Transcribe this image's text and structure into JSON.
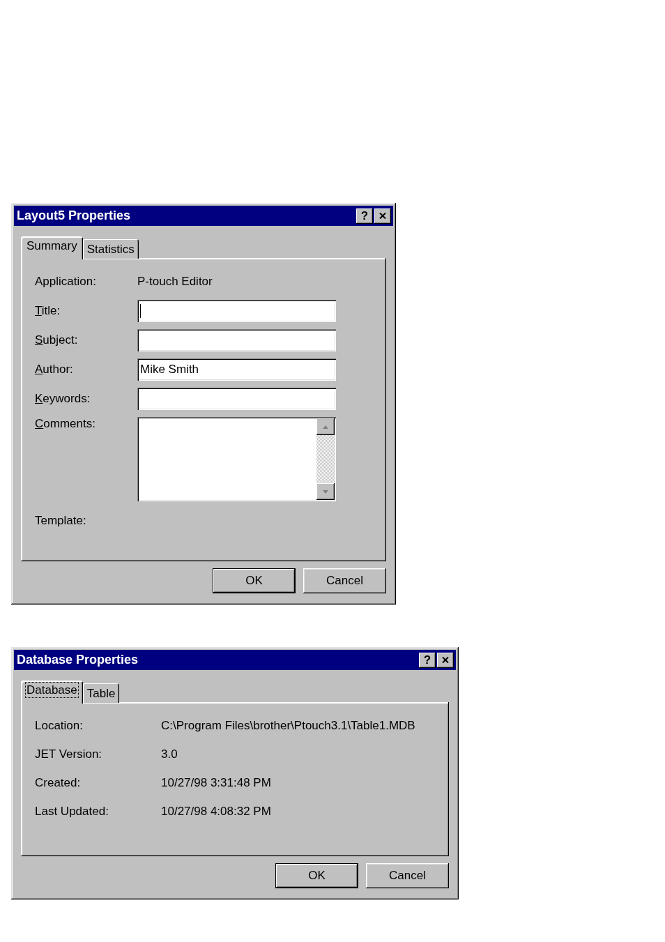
{
  "dialogs": [
    {
      "title": "Layout5 Properties",
      "help": "?",
      "tabs": [
        {
          "label": "Summary",
          "selected": true,
          "focused": false
        },
        {
          "label": "Statistics",
          "selected": false,
          "focused": false
        }
      ],
      "rows": [
        {
          "kind": "static",
          "label": "Application:",
          "value": "P-touch Editor",
          "underline_first": false
        },
        {
          "kind": "input",
          "label": "Title:",
          "value": "",
          "focused": true,
          "underline_first": true
        },
        {
          "kind": "input",
          "label": "Subject:",
          "value": "",
          "focused": false,
          "underline_first": true
        },
        {
          "kind": "input",
          "label": "Author:",
          "value": "Mike Smith",
          "focused": false,
          "underline_first": true
        },
        {
          "kind": "input",
          "label": "Keywords:",
          "value": "",
          "focused": false,
          "underline_first": true
        },
        {
          "kind": "textarea",
          "label": "Comments:",
          "value": "",
          "focused": false,
          "underline_first": true
        },
        {
          "kind": "label",
          "label": "Template:",
          "underline_first": false
        }
      ],
      "buttons": [
        {
          "label": "OK",
          "default": true
        },
        {
          "label": "Cancel",
          "default": false
        }
      ]
    },
    {
      "title": "Database Properties",
      "help": "?",
      "tabs": [
        {
          "label": "Database",
          "selected": true,
          "focused": true
        },
        {
          "label": "Table",
          "selected": false,
          "focused": false
        }
      ],
      "rows": [
        {
          "kind": "static",
          "label": "Location:",
          "value": "C:\\Program Files\\brother\\Ptouch3.1\\Table1.MDB",
          "underline_first": false
        },
        {
          "kind": "static",
          "label": "JET Version:",
          "value": "3.0",
          "underline_first": false
        },
        {
          "kind": "static",
          "label": "Created:",
          "value": "10/27/98 3:31:48 PM",
          "underline_first": false
        },
        {
          "kind": "static",
          "label": "Last Updated:",
          "value": "10/27/98 4:08:32 PM",
          "underline_first": false
        }
      ],
      "buttons": [
        {
          "label": "OK",
          "default": true
        },
        {
          "label": "Cancel",
          "default": false
        }
      ]
    }
  ]
}
